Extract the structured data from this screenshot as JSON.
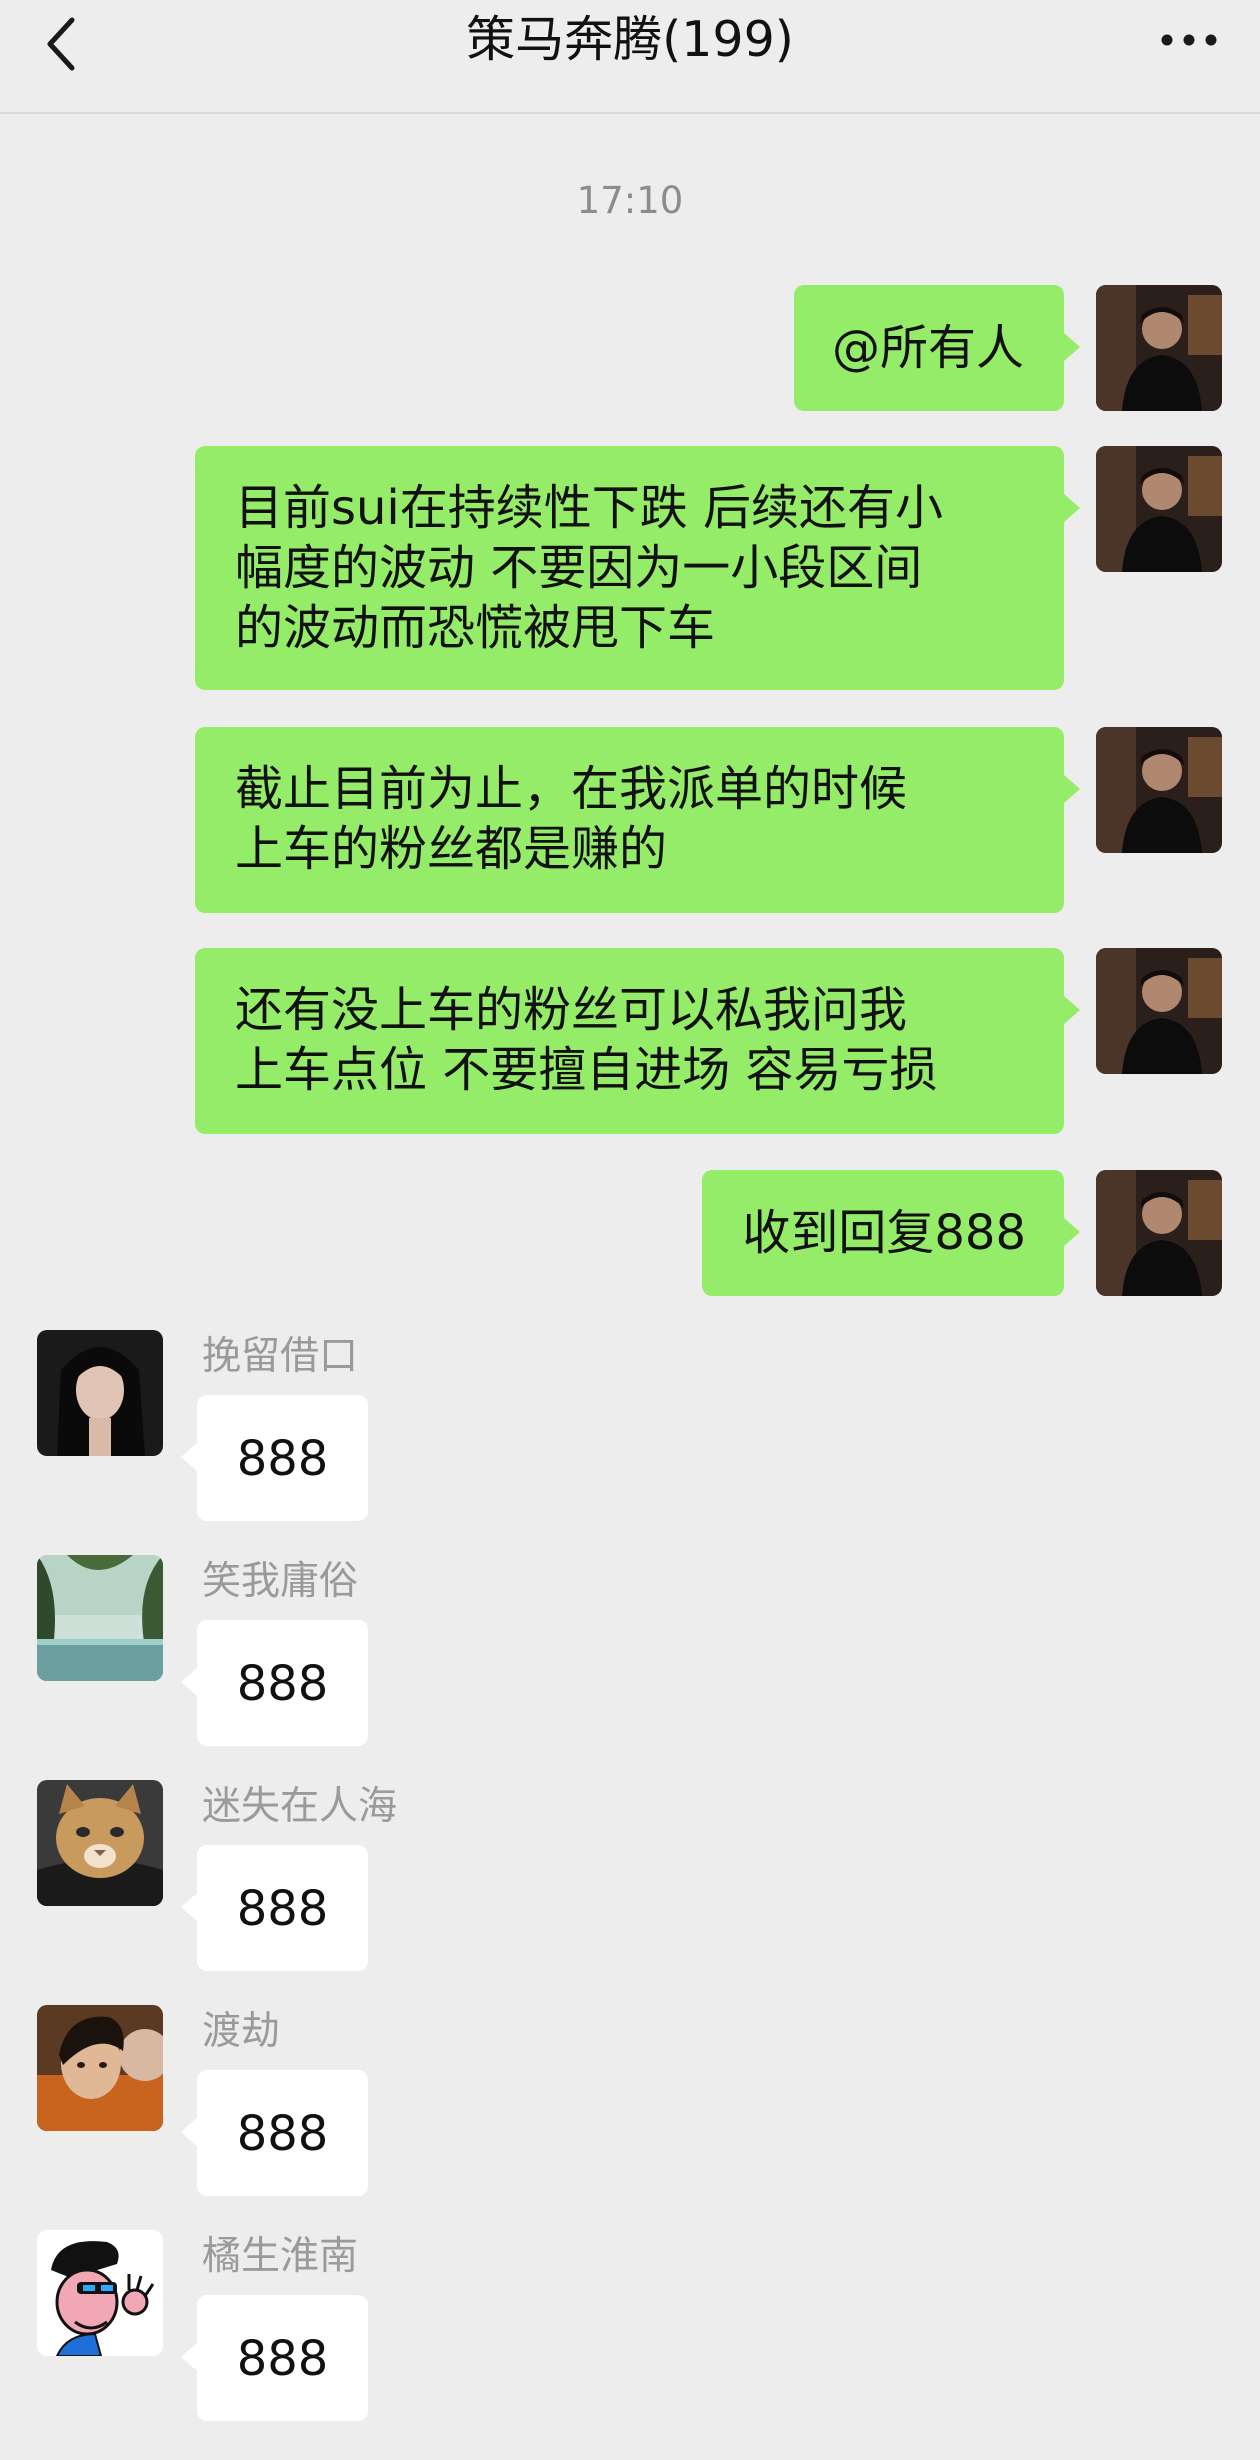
{
  "header": {
    "title": "策马奔腾(199)",
    "back_icon": "chevron-left-icon",
    "more_icon": "more-horizontal-icon"
  },
  "timestamp": "17:10",
  "colors": {
    "background": "#ededed",
    "self_bubble": "#95ec69",
    "other_bubble": "#ffffff"
  },
  "outgoing": [
    {
      "lines": [
        "@所有人"
      ]
    },
    {
      "lines": [
        "目前sui在持续性下跌 后续还有小",
        "幅度的波动 不要因为一小段区间",
        "的波动而恐慌被甩下车"
      ]
    },
    {
      "lines": [
        "截止目前为止，在我派单的时候",
        "上车的粉丝都是赚的"
      ]
    },
    {
      "lines": [
        "还有没上车的粉丝可以私我问我",
        "上车点位 不要擅自进场 容易亏损"
      ]
    },
    {
      "lines": [
        "收到回复888"
      ]
    }
  ],
  "incoming": [
    {
      "sender": "挽留借口",
      "text": "888"
    },
    {
      "sender": "笑我庸俗",
      "text": "888"
    },
    {
      "sender": "迷失在人海",
      "text": "888"
    },
    {
      "sender": "渡劫",
      "text": "888"
    },
    {
      "sender": "橘生淮南",
      "text": "888"
    }
  ]
}
